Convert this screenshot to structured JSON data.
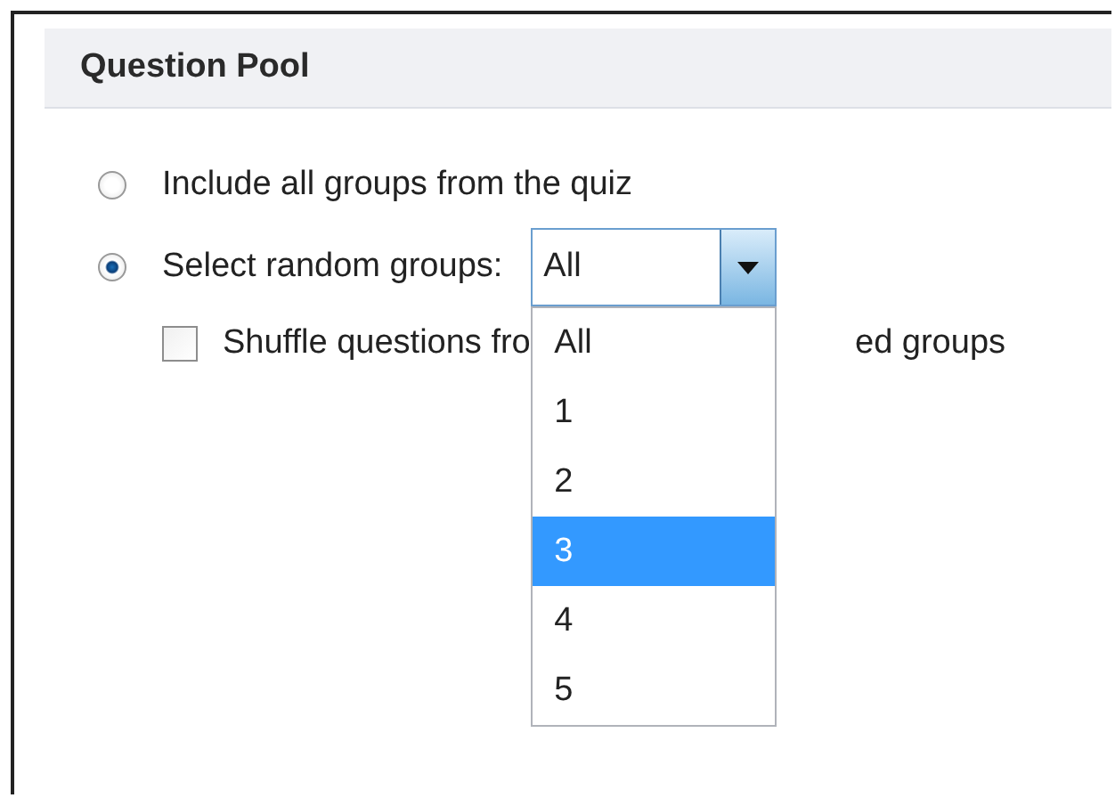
{
  "section": {
    "title": "Question Pool"
  },
  "options": [
    {
      "kind": "radio",
      "label": "Include all groups from the quiz",
      "selected": false
    },
    {
      "kind": "radio",
      "label": "Select random groups:",
      "selected": true,
      "dropdown": {
        "value": "All",
        "expanded": true,
        "items": [
          {
            "label": "All",
            "highlighted": false
          },
          {
            "label": "1",
            "highlighted": false
          },
          {
            "label": "2",
            "highlighted": false
          },
          {
            "label": "3",
            "highlighted": true
          },
          {
            "label": "4",
            "highlighted": false
          },
          {
            "label": "5",
            "highlighted": false
          }
        ]
      }
    },
    {
      "kind": "checkbox",
      "label_parts": [
        "Shuffle questions fro",
        "ed groups"
      ],
      "checked": false
    }
  ]
}
